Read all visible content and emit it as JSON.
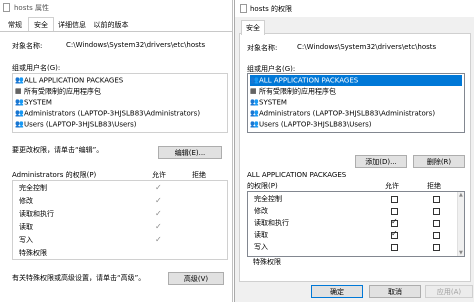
{
  "left": {
    "title": "hosts 属性",
    "tabs": [
      "常规",
      "安全",
      "详细信息",
      "以前的版本"
    ],
    "object_label": "对象名称:",
    "object_value": "C:\\Windows\\System32\\drivers\\etc\\hosts",
    "groups_label": "组或用户名(G):",
    "groups": [
      {
        "icon": "users-icon",
        "label": "ALL APPLICATION PACKAGES"
      },
      {
        "icon": "package-icon",
        "label": "所有受限制的应用程序包"
      },
      {
        "icon": "users-icon",
        "label": "SYSTEM"
      },
      {
        "icon": "users-icon",
        "label": "Administrators (LAPTOP-3HJSLB83\\Administrators)"
      },
      {
        "icon": "users-icon",
        "label": "Users (LAPTOP-3HJSLB83\\Users)"
      }
    ],
    "change_hint": "要更改权限，请单击“编辑”。",
    "edit_button": "编辑(E)...",
    "perm_header": "Administrators 的权限(P)",
    "allow_header": "允许",
    "deny_header": "拒绝",
    "permissions": [
      {
        "name": "完全控制",
        "allow": true
      },
      {
        "name": "修改",
        "allow": true
      },
      {
        "name": "读取和执行",
        "allow": true
      },
      {
        "name": "读取",
        "allow": true
      },
      {
        "name": "写入",
        "allow": true
      },
      {
        "name": "特殊权限",
        "allow": false
      }
    ],
    "advanced_hint": "有关特殊权限或高级设置，请单击“高级”。",
    "advanced_button": "高级(V)"
  },
  "right": {
    "title": "hosts 的权限",
    "tab": "安全",
    "object_label": "对象名称:",
    "object_value": "C:\\Windows\\System32\\drivers\\etc\\hosts",
    "groups_label": "组或用户名(G):",
    "groups": [
      {
        "icon": "users-icon",
        "label": "ALL APPLICATION PACKAGES"
      },
      {
        "icon": "package-icon",
        "label": "所有受限制的应用程序包"
      },
      {
        "icon": "users-icon",
        "label": "SYSTEM"
      },
      {
        "icon": "users-icon",
        "label": "Administrators (LAPTOP-3HJSLB83\\Administrators)"
      },
      {
        "icon": "users-icon",
        "label": "Users (LAPTOP-3HJSLB83\\Users)"
      }
    ],
    "selected_index": 0,
    "add_button": "添加(D)...",
    "remove_button": "删除(R)",
    "perm_header_line1": "ALL APPLICATION PACKAGES",
    "perm_header_line2": "的权限(P)",
    "allow_header": "允许",
    "deny_header": "拒绝",
    "permissions": [
      {
        "name": "完全控制",
        "allow": false,
        "deny": false
      },
      {
        "name": "修改",
        "allow": false,
        "deny": false
      },
      {
        "name": "读取和执行",
        "allow": true,
        "deny": false
      },
      {
        "name": "读取",
        "allow": true,
        "deny": false
      },
      {
        "name": "写入",
        "allow": false,
        "deny": false
      },
      {
        "name": "特殊权限",
        "allow": false,
        "deny": false
      }
    ],
    "ok_button": "确定",
    "cancel_button": "取消",
    "apply_button": "应用(A)"
  }
}
